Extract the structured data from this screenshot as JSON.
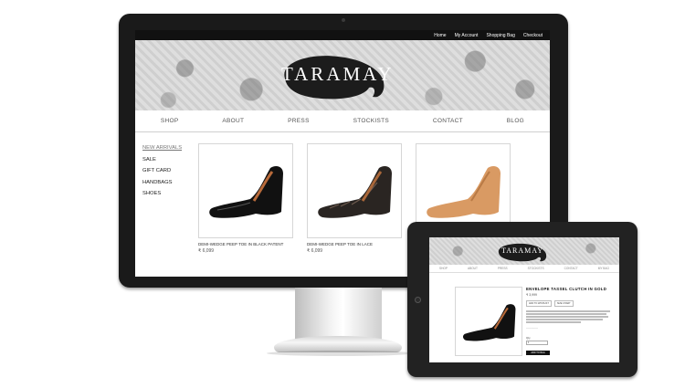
{
  "desktop": {
    "topbar": {
      "links": [
        "Home",
        "My Account",
        "Shopping Bag",
        "Checkout"
      ]
    },
    "logo": "TARAMAY",
    "nav": [
      "SHOP",
      "ABOUT",
      "PRESS",
      "STOCKISTS",
      "CONTACT",
      "BLOG"
    ],
    "sidebar": [
      {
        "label": "NEW ARRIVALS",
        "active": true
      },
      {
        "label": "SALE"
      },
      {
        "label": "GIFT CARD"
      },
      {
        "label": "HANDBAGS"
      },
      {
        "label": "SHOES"
      }
    ],
    "products": [
      {
        "name": "DEMI-WEDGE PEEP TOE IN BLACK PATENT",
        "price": "6,099",
        "color": "#111111"
      },
      {
        "name": "DEMI-WEDGE PEEP TOE IN LACE",
        "price": "6,099",
        "color": "#2a2522"
      },
      {
        "name": "",
        "price": "",
        "color": "#d99a63"
      }
    ],
    "currency_icon": "rupee-icon"
  },
  "tablet": {
    "logo": "TARAMAY",
    "nav": [
      "SHOP",
      "ABOUT",
      "PRESS",
      "STOCKISTS",
      "CONTACT",
      "MY BAG"
    ],
    "product": {
      "title": "ENVELOPE TASSEL CLUTCH IN GOLD",
      "price": "₹ 3,999",
      "buttons": [
        "ADD TO WISHLIST",
        "SIZE CHART"
      ],
      "qty_label": "Qty",
      "qty_value": "1",
      "add_button": "ADD TO BAG"
    }
  }
}
